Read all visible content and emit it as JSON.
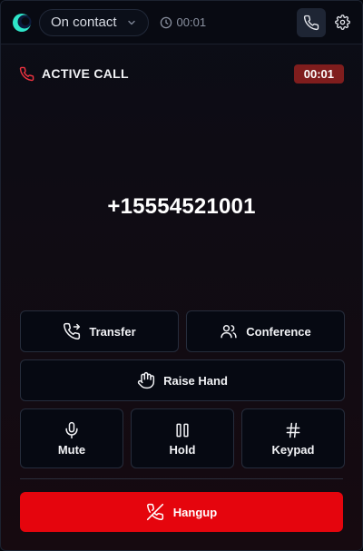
{
  "header": {
    "status_label": "On contact",
    "call_timer": "00:01"
  },
  "call": {
    "state_label": "ACTIVE CALL",
    "duration": "00:01",
    "phone_number": "+15554521001"
  },
  "actions": {
    "transfer": "Transfer",
    "conference": "Conference",
    "raise_hand": "Raise Hand",
    "mute": "Mute",
    "hold": "Hold",
    "keypad": "Keypad",
    "hangup": "Hangup"
  },
  "colors": {
    "accent_red": "#e5050d",
    "badge_red": "#7f1d1d",
    "logo_teal": "#2ee6c9"
  },
  "icons": [
    "logo-icon",
    "chevron-down-icon",
    "clock-icon",
    "phone-icon",
    "gear-icon",
    "phone-red-icon",
    "phone-forward-icon",
    "users-icon",
    "hand-icon",
    "microphone-icon",
    "pause-icon",
    "hash-icon",
    "phone-off-icon"
  ]
}
